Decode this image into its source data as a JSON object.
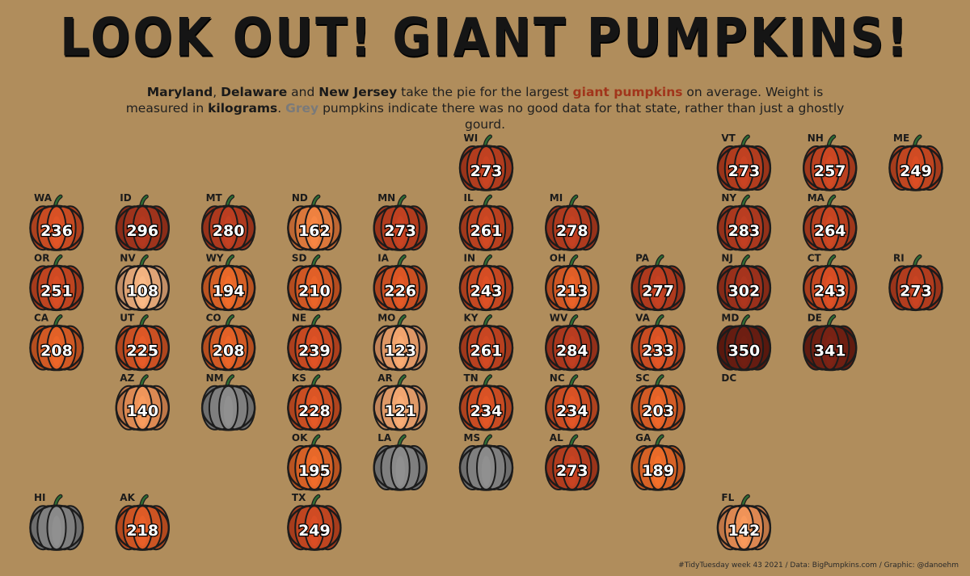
{
  "title": "LOOK OUT! GIANT PUMPKINS!",
  "subtitle": {
    "s1": "Maryland",
    "s2": ", ",
    "s3": "Delaware",
    "s4": " and ",
    "s5": "New Jersey",
    "s6": " take the pie for the largest ",
    "s7": "giant pumpkins",
    "s8": " on average. Weight is measured in ",
    "s9": "kilograms",
    "s10": ". ",
    "s11": "Grey",
    "s12": " pumpkins indicate there was no good data for that state, rather than just a ghostly gourd."
  },
  "caption": "#TidyTuesday week 43 2021 / Data: BigPumpkins.com / Graphic: @danoehm",
  "colors": {
    "background": "#b08d5c",
    "highlight_red": "#a1351b",
    "no_data_grey": "#8a8a8a",
    "stem": "#2e6b33"
  },
  "chart_data": {
    "type": "tile-map",
    "unit": "kg",
    "color_scale": "lighter orange = lower weight, darker red-brown = higher weight; grey = no data",
    "tiles": [
      {
        "state": "WI",
        "col": 5,
        "row": 0,
        "value": 273
      },
      {
        "state": "VT",
        "col": 8,
        "row": 0,
        "value": 273
      },
      {
        "state": "NH",
        "col": 9,
        "row": 0,
        "value": 257
      },
      {
        "state": "ME",
        "col": 10,
        "row": 0,
        "value": 249
      },
      {
        "state": "WA",
        "col": 0,
        "row": 1,
        "value": 236
      },
      {
        "state": "ID",
        "col": 1,
        "row": 1,
        "value": 296
      },
      {
        "state": "MT",
        "col": 2,
        "row": 1,
        "value": 280
      },
      {
        "state": "ND",
        "col": 3,
        "row": 1,
        "value": 162
      },
      {
        "state": "MN",
        "col": 4,
        "row": 1,
        "value": 273
      },
      {
        "state": "IL",
        "col": 5,
        "row": 1,
        "value": 261
      },
      {
        "state": "MI",
        "col": 6,
        "row": 1,
        "value": 278
      },
      {
        "state": "NY",
        "col": 8,
        "row": 1,
        "value": 283
      },
      {
        "state": "MA",
        "col": 9,
        "row": 1,
        "value": 264
      },
      {
        "state": "OR",
        "col": 0,
        "row": 2,
        "value": 251
      },
      {
        "state": "NV",
        "col": 1,
        "row": 2,
        "value": 108
      },
      {
        "state": "WY",
        "col": 2,
        "row": 2,
        "value": 194
      },
      {
        "state": "SD",
        "col": 3,
        "row": 2,
        "value": 210
      },
      {
        "state": "IA",
        "col": 4,
        "row": 2,
        "value": 226
      },
      {
        "state": "IN",
        "col": 5,
        "row": 2,
        "value": 243
      },
      {
        "state": "OH",
        "col": 6,
        "row": 2,
        "value": 213
      },
      {
        "state": "PA",
        "col": 7,
        "row": 2,
        "value": 277
      },
      {
        "state": "NJ",
        "col": 8,
        "row": 2,
        "value": 302
      },
      {
        "state": "CT",
        "col": 9,
        "row": 2,
        "value": 243
      },
      {
        "state": "RI",
        "col": 10,
        "row": 2,
        "value": 273
      },
      {
        "state": "CA",
        "col": 0,
        "row": 3,
        "value": 208
      },
      {
        "state": "UT",
        "col": 1,
        "row": 3,
        "value": 225
      },
      {
        "state": "CO",
        "col": 2,
        "row": 3,
        "value": 208
      },
      {
        "state": "NE",
        "col": 3,
        "row": 3,
        "value": 239
      },
      {
        "state": "MO",
        "col": 4,
        "row": 3,
        "value": 123
      },
      {
        "state": "KY",
        "col": 5,
        "row": 3,
        "value": 261
      },
      {
        "state": "WV",
        "col": 6,
        "row": 3,
        "value": 284
      },
      {
        "state": "VA",
        "col": 7,
        "row": 3,
        "value": 233
      },
      {
        "state": "MD",
        "col": 8,
        "row": 3,
        "value": 350
      },
      {
        "state": "DE",
        "col": 9,
        "row": 3,
        "value": 341
      },
      {
        "state": "AZ",
        "col": 1,
        "row": 4,
        "value": 140
      },
      {
        "state": "NM",
        "col": 2,
        "row": 4,
        "value": null
      },
      {
        "state": "KS",
        "col": 3,
        "row": 4,
        "value": 228
      },
      {
        "state": "AR",
        "col": 4,
        "row": 4,
        "value": 121
      },
      {
        "state": "TN",
        "col": 5,
        "row": 4,
        "value": 234
      },
      {
        "state": "NC",
        "col": 6,
        "row": 4,
        "value": 234
      },
      {
        "state": "SC",
        "col": 7,
        "row": 4,
        "value": 203
      },
      {
        "state": "DC",
        "col": 8,
        "row": 4,
        "value": null,
        "no_pumpkin": true
      },
      {
        "state": "OK",
        "col": 3,
        "row": 5,
        "value": 195
      },
      {
        "state": "LA",
        "col": 4,
        "row": 5,
        "value": null
      },
      {
        "state": "MS",
        "col": 5,
        "row": 5,
        "value": null
      },
      {
        "state": "AL",
        "col": 6,
        "row": 5,
        "value": 273
      },
      {
        "state": "GA",
        "col": 7,
        "row": 5,
        "value": 189
      },
      {
        "state": "HI",
        "col": 0,
        "row": 6,
        "value": null
      },
      {
        "state": "AK",
        "col": 1,
        "row": 6,
        "value": 218
      },
      {
        "state": "TX",
        "col": 3,
        "row": 6,
        "value": 249
      },
      {
        "state": "FL",
        "col": 8,
        "row": 6,
        "value": 142
      }
    ]
  }
}
